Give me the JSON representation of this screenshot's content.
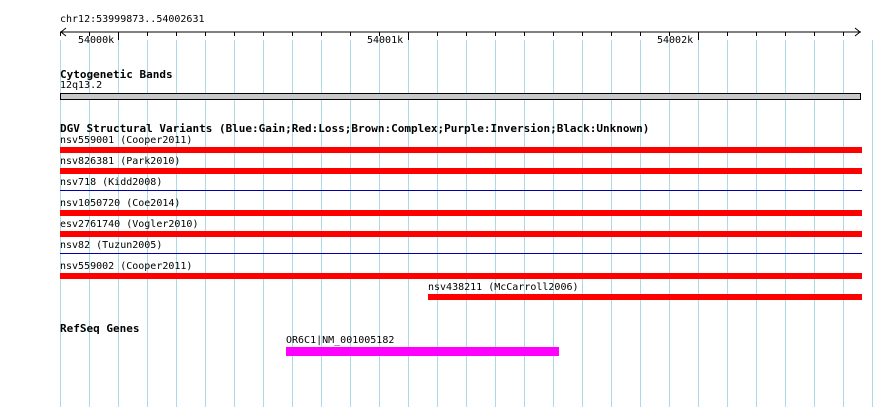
{
  "ruler": {
    "locus": "chr12:53999873..54002631",
    "ticks": [
      {
        "label": "54000k"
      },
      {
        "label": "54001k"
      },
      {
        "label": "54002k"
      }
    ]
  },
  "tracks": {
    "cytogenetic": {
      "title": "Cytogenetic Bands",
      "band": "12q13.2",
      "band_color": "#c8c8c8"
    },
    "dgv": {
      "title": "DGV Structural Variants (Blue:Gain;Red:Loss;Brown:Complex;Purple:Inversion;Black:Unknown)",
      "colors": {
        "loss": "#ff0000",
        "gain": "#0000aa"
      },
      "variants": [
        {
          "label": "nsv559001 (Cooper2011)",
          "type": "loss"
        },
        {
          "label": "nsv826381 (Park2010)",
          "type": "loss"
        },
        {
          "label": "nsv718 (Kidd2008)",
          "type": "gain"
        },
        {
          "label": "nsv1050720 (Coe2014)",
          "type": "loss"
        },
        {
          "label": "esv2761740 (Vogler2010)",
          "type": "loss"
        },
        {
          "label": "nsv82 (Tuzun2005)",
          "type": "gain"
        },
        {
          "label": "nsv559002 (Cooper2011)",
          "type": "loss"
        },
        {
          "label": "nsv438211 (McCarroll2006)",
          "type": "loss"
        }
      ]
    },
    "refseq": {
      "title": "RefSeq Genes",
      "gene_label": "OR6C1|NM_001005182",
      "gene_color": "#ff00ff"
    }
  },
  "colors": {
    "grid": "#add8e6",
    "background": "#ffffff"
  }
}
